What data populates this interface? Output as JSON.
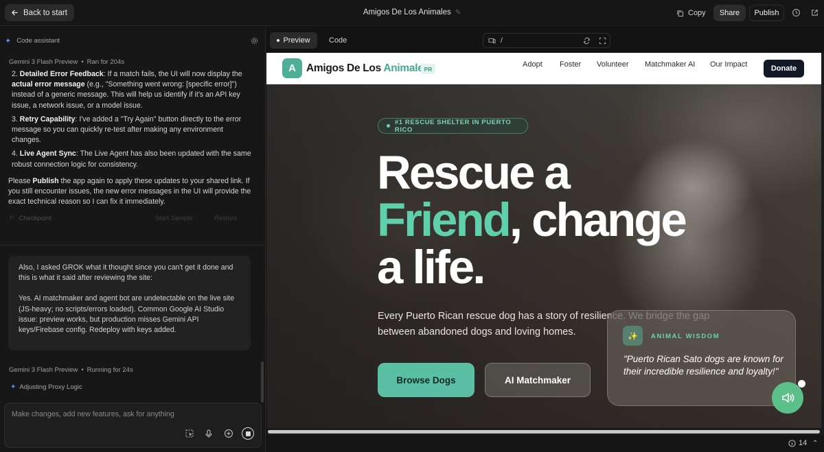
{
  "topbar": {
    "back_label": "Back to start",
    "app_title": "Amigos De Los Animales",
    "copy_label": "Copy",
    "share_label": "Share",
    "publish_label": "Publish"
  },
  "assistant": {
    "header": "Code assistant",
    "run1": {
      "model": "Gemini 3 Flash Preview",
      "status": "Ran for 204s"
    },
    "items": [
      {
        "num": "2.",
        "title": "Detailed Error Feedback",
        "pre": ": If a match fails, the UI will now display the ",
        "bold": "actual error message",
        "post": " (e.g., \"Something went wrong: [specific error]\") instead of a generic message. This will help us identify if it's an API key issue, a network issue, or a model issue."
      },
      {
        "num": "3.",
        "title": "Retry Capability",
        "text": ": I've added a \"Try Again\" button directly to the error message so you can quickly re-test after making any environment changes."
      },
      {
        "num": "4.",
        "title": "Live Agent Sync",
        "text": ": The Live Agent has also been updated with the same robust connection logic for consistency."
      }
    ],
    "closing_pre": "Please ",
    "closing_bold": "Publish",
    "closing_post": " the app again to apply these updates to your shared link. If you still encounter issues, the new error messages in the UI will provide the exact technical reason so I can fix it immediately.",
    "checkpoint": "Checkpoint",
    "faded_action_1": "Start Sample",
    "faded_action_2": "Restore",
    "user_message_p1": "Also, I asked GROK what it thought since you can't get it done and this is what it said after reviewing the site:",
    "user_message_p2": "Yes. AI matchmaker and agent bot are undetectable on the live site (JS-heavy; no scripts/errors loaded). Common Google AI Studio issue: preview works, but production misses Gemini API keys/Firebase config. Redeploy with keys added.",
    "run2": {
      "model": "Gemini 3 Flash Preview",
      "status": "Running for 24s"
    },
    "thinking": "Adjusting Proxy Logic",
    "input_placeholder": "Make changes, add new features, ask for anything"
  },
  "preview_tabs": {
    "preview": "Preview",
    "code": "Code",
    "url_path": "/"
  },
  "site": {
    "logo_letter": "A",
    "brand_part1": "Amigos De Los ",
    "brand_part2": "Animales",
    "brand_badge": "PR",
    "nav": [
      "Adopt",
      "Foster",
      "Volunteer",
      "Matchmaker AI",
      "Our Impact"
    ],
    "donate": "Donate",
    "pill": "#1 RESCUE SHELTER IN PUERTO RICO",
    "headline_1": "Rescue a",
    "headline_green": "Friend",
    "headline_2": ", change",
    "headline_3": "a life.",
    "subtitle": "Every Puerto Rican rescue dog has a story of resilience. We bridge the gap between abandoned dogs and loving homes.",
    "browse_btn": "Browse Dogs",
    "ai_btn": "AI Matchmaker",
    "wisdom_label": "ANIMAL WISDOM",
    "wisdom_quote": "\"Puerto Rican Sato dogs are known for their incredible resilience and loyalty!\""
  },
  "statusbar": {
    "count": "14"
  },
  "colors": {
    "accent": "#5abfa3",
    "brand_green": "#45a98f",
    "donate_bg": "#111827"
  }
}
